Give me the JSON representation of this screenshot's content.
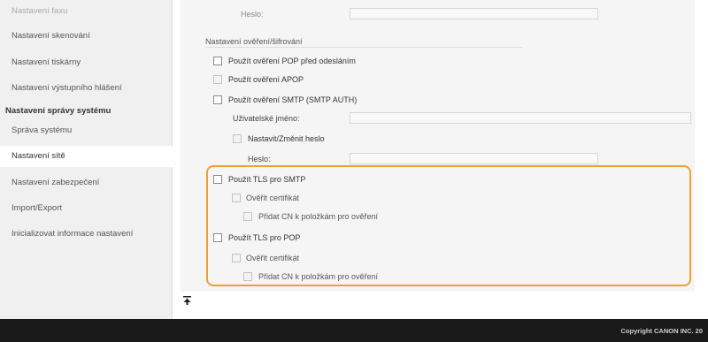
{
  "sidebar": {
    "items": [
      {
        "label": "Nastavení faxu"
      },
      {
        "label": "Nastavení skenování"
      },
      {
        "label": "Nastavení tiskárny"
      },
      {
        "label": "Nastavení výstupního hlášení"
      }
    ],
    "heading": "Nastavení správy systému",
    "sub_items": [
      {
        "label": "Správa systému"
      },
      {
        "label": "Nastavení sítě"
      },
      {
        "label": "Nastavení zabezpečení"
      },
      {
        "label": "Import/Export"
      },
      {
        "label": "Inicializovat informace nastavení"
      }
    ]
  },
  "form": {
    "heslo_top_label": "Heslo:",
    "section_title": "Nastavení ověření/šifrování",
    "pop_before_send": "Použít ověření POP před odesláním",
    "apop": "Použít ověření APOP",
    "smtp_auth": "Použít ověření SMTP (SMTP AUTH)",
    "username_label": "Uživatelské jméno:",
    "set_change_password": "Nastavit/Změnit heslo",
    "password_label": "Heslo:",
    "tls_smtp": "Použít TLS pro SMTP",
    "verify_cert_smtp": "Ověřit certifikát",
    "add_cn_smtp": "Přidat CN k položkám pro ověření",
    "tls_pop": "Použít TLS pro POP",
    "verify_cert_pop": "Ověřit certifikát",
    "add_cn_pop": "Přidat CN k položkám pro ověření"
  },
  "footer": {
    "copyright": "Copyright CANON INC. 20"
  },
  "colors": {
    "highlight": "#f0a030",
    "footer_bg": "#1a1a1a"
  }
}
